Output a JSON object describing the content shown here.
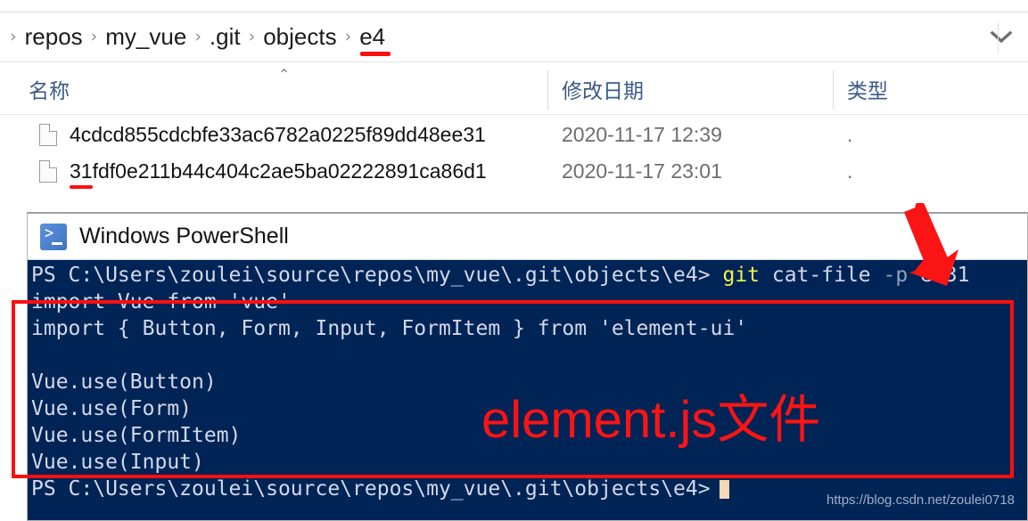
{
  "explorer": {
    "breadcrumb": {
      "separator": "›",
      "items": [
        {
          "label": "repos",
          "underlined": false
        },
        {
          "label": "my_vue",
          "underlined": false
        },
        {
          "label": ".git",
          "underlined": false
        },
        {
          "label": "objects",
          "underlined": false
        },
        {
          "label": "e4",
          "underlined": true
        }
      ],
      "dropdown_icon": "chevron-down-icon"
    },
    "columns": {
      "name": "名称",
      "date_modified": "修改日期",
      "type": "类型",
      "sort_caret": "⌃"
    },
    "files": [
      {
        "name": "4cdcd855cdcbfe33ac6782a0225f89dd48ee31",
        "date": "2020-11-17 12:39",
        "type": ".",
        "underlined": false
      },
      {
        "name": "31fdf0e211b44c404c2ae5ba02222891ca86d1",
        "date": "2020-11-17 23:01",
        "type": ".",
        "underlined": true
      }
    ]
  },
  "powershell": {
    "title": "Windows PowerShell",
    "icon": "powershell-icon",
    "prompt_path": "PS C:\\Users\\zoulei\\source\\repos\\my_vue\\.git\\objects\\e4>",
    "command_name": "git",
    "command_args": " cat-file ",
    "command_param": "-p",
    "command_tail": " e431",
    "output_lines": [
      "import Vue from 'vue'",
      "import { Button, Form, Input, FormItem } from 'element-ui'",
      "",
      "Vue.use(Button)",
      "Vue.use(Form)",
      "Vue.use(FormItem)",
      "Vue.use(Input)"
    ],
    "final_prompt": "PS C:\\Users\\zoulei\\source\\repos\\my_vue\\.git\\objects\\e4>"
  },
  "annotations": {
    "label": "element.js文件",
    "label_color": "#fb1414",
    "box_color": "#fb0f0f",
    "arrow": "down-arrow-annotation"
  },
  "watermark": "https://blog.csdn.net/zoulei0718"
}
